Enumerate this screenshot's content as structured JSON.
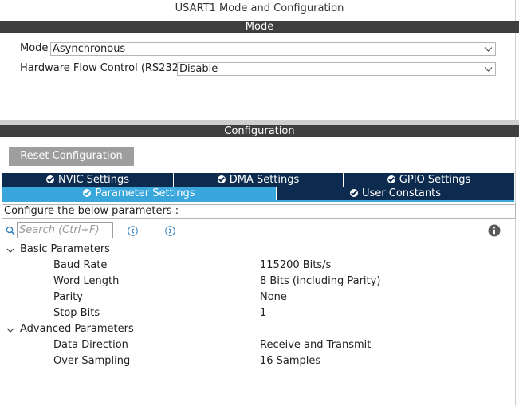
{
  "window": {
    "title": "USART1 Mode and Configuration"
  },
  "mode_section": {
    "header": "Mode",
    "mode": {
      "label": "Mode",
      "value": "Asynchronous"
    },
    "flow_control": {
      "label": "Hardware Flow Control (RS232)",
      "value": "Disable"
    }
  },
  "config_section": {
    "header": "Configuration",
    "reset_button": "Reset Configuration",
    "tabs": [
      {
        "label": "NVIC Settings",
        "active": false
      },
      {
        "label": "DMA Settings",
        "active": false
      },
      {
        "label": "GPIO Settings",
        "active": false
      },
      {
        "label": "Parameter Settings",
        "active": true
      },
      {
        "label": "User Constants",
        "active": false
      }
    ],
    "hint": "Configure the below parameters :",
    "search_placeholder": "Search (Ctrl+F)"
  },
  "parameters": {
    "basic": {
      "title": "Basic Parameters",
      "rows": [
        {
          "name": "Baud Rate",
          "value": "115200 Bits/s"
        },
        {
          "name": "Word Length",
          "value": "8 Bits (including Parity)"
        },
        {
          "name": "Parity",
          "value": "None"
        },
        {
          "name": "Stop Bits",
          "value": "1"
        }
      ]
    },
    "advanced": {
      "title": "Advanced Parameters",
      "rows": [
        {
          "name": "Data Direction",
          "value": "Receive and Transmit"
        },
        {
          "name": "Over Sampling",
          "value": "16 Samples"
        }
      ]
    }
  },
  "colors": {
    "section_bar": "#3f3f3f",
    "tab_inactive": "#0d2b4e",
    "tab_active": "#3aa7dc",
    "reset_button": "#9e9e9e"
  }
}
